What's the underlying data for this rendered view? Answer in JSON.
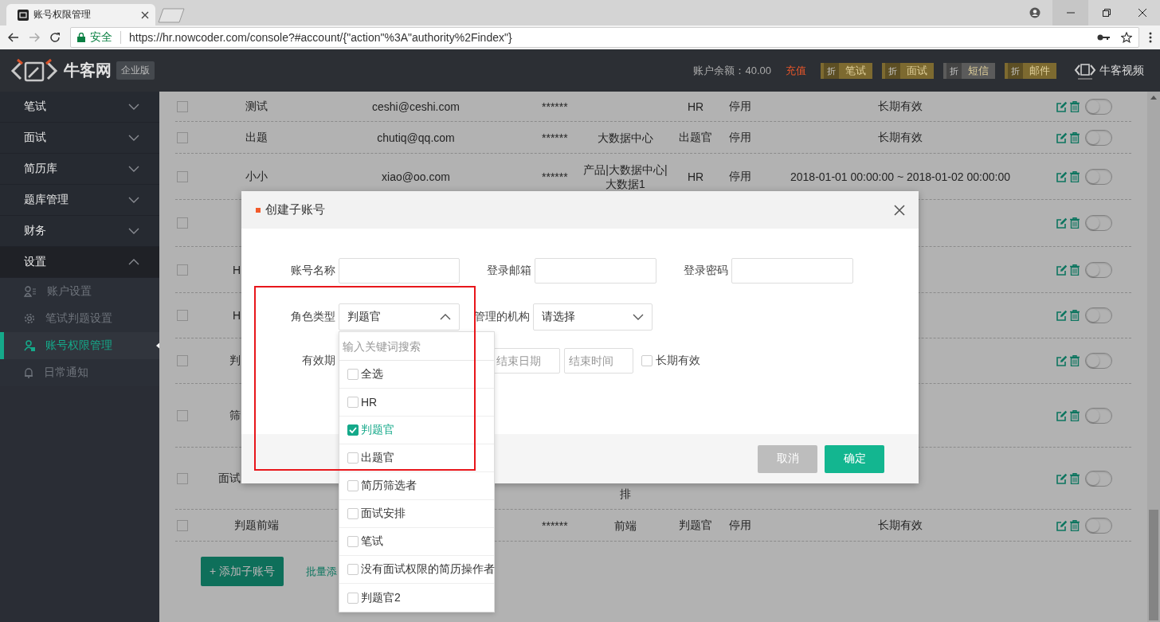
{
  "browser": {
    "tab_title": "账号权限管理",
    "security_label": "安全",
    "url": "https://hr.nowcoder.com/console?#account/{\"action\"%3A\"authority%2Findex\"}"
  },
  "header": {
    "logo_text": "牛客网",
    "edition_badge": "企业版",
    "balance": "账户余额：40.00",
    "recharge_link": "充值",
    "services": [
      {
        "tag": "折",
        "label": "笔试",
        "color": "#7d6a30"
      },
      {
        "tag": "折",
        "label": "面试",
        "color": "#7d6a30"
      },
      {
        "tag": "折",
        "label": "短信",
        "color": "#5b5b5b"
      },
      {
        "tag": "折",
        "label": "邮件",
        "color": "#7d6a30"
      }
    ],
    "video_link": "牛客视频"
  },
  "sidebar": {
    "items": [
      {
        "label": "笔试",
        "expanded": false
      },
      {
        "label": "面试",
        "expanded": false
      },
      {
        "label": "简历库",
        "expanded": false
      },
      {
        "label": "题库管理",
        "expanded": false
      },
      {
        "label": "财务",
        "expanded": false
      },
      {
        "label": "设置",
        "expanded": true,
        "children": [
          {
            "label": "账户设置",
            "selected": false
          },
          {
            "label": "笔试判题设置",
            "selected": false
          },
          {
            "label": "账号权限管理",
            "selected": true
          },
          {
            "label": "日常通知",
            "selected": false
          }
        ]
      }
    ]
  },
  "table": {
    "rows": [
      {
        "checked": false,
        "name": "测试",
        "email": "ceshi@ceshi.com",
        "password": "******",
        "role": "HR",
        "status": "停用",
        "validity": "长期有效",
        "enabled": false
      },
      {
        "checked": false,
        "name": "出题",
        "email": "chutiq@qq.com",
        "password": "******",
        "org": "大数据中心",
        "role": "出题官",
        "status": "停用",
        "validity": "长期有效",
        "enabled": false
      },
      {
        "checked": false,
        "name": "小小",
        "email": "xiao@oo.com",
        "password": "******",
        "org": "产品|大数据中心|大数据1",
        "role": "HR",
        "status": "停用",
        "validity": "2018-01-01 00:00:00 ~ 2018-01-02 00:00:00",
        "enabled": false
      },
      {
        "checked": false,
        "enabled": false
      },
      {
        "checked": false,
        "name": "H",
        "enabled": false
      },
      {
        "checked": false,
        "name": "H",
        "enabled": false
      },
      {
        "checked": false,
        "name": "判",
        "enabled": false
      },
      {
        "checked": false,
        "name": "筛",
        "enabled": false
      },
      {
        "checked": false,
        "name": "面试",
        "org": "排",
        "enabled": false
      },
      {
        "checked": false,
        "name": "判题前端",
        "password": "******",
        "org": "前端",
        "role": "判题官",
        "status": "停用",
        "validity": "长期有效",
        "enabled": false
      }
    ]
  },
  "add_button": "+ 添加子账号",
  "batch_link": "批量添",
  "dialog": {
    "title": "创建子账号",
    "account_name": {
      "label": "账号名称"
    },
    "login_email": {
      "label": "登录邮箱"
    },
    "login_password": {
      "label": "登录密码"
    },
    "role_type": {
      "label": "角色类型",
      "value": "判题官",
      "expanded": true
    },
    "managed_org": {
      "label": "管理的机构",
      "value": "请选择",
      "expanded": false
    },
    "validity": {
      "label": "有效期",
      "end_date_placeholder": "结束日期",
      "end_time_placeholder": "结束时间",
      "long_term": {
        "label": "长期有效",
        "checked": false
      }
    },
    "role_dropdown": {
      "search_placeholder": "输入关键词搜索",
      "options": [
        {
          "label": "全选",
          "checked": false
        },
        {
          "label": "HR",
          "checked": false
        },
        {
          "label": "判题官",
          "checked": true
        },
        {
          "label": "出题官",
          "checked": false
        },
        {
          "label": "简历筛选者",
          "checked": false
        },
        {
          "label": "面试安排",
          "checked": false
        },
        {
          "label": "笔试",
          "checked": false
        },
        {
          "label": "没有面试权限的简历操作者",
          "checked": false
        },
        {
          "label": "判题官2",
          "checked": false
        }
      ]
    },
    "buttons": [
      {
        "label": "取消",
        "kind": "cancel"
      },
      {
        "label": "确定",
        "kind": "confirm"
      }
    ]
  }
}
